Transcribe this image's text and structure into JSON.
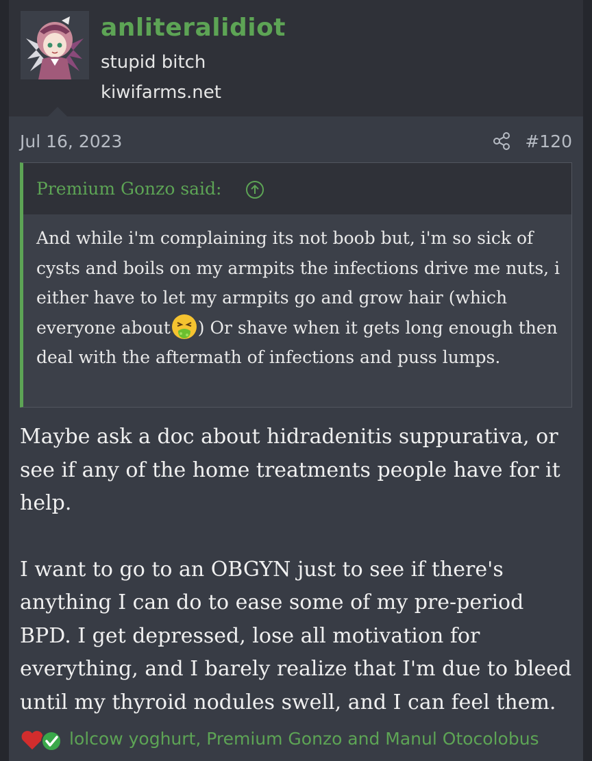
{
  "user": {
    "username": "anliteralidiot",
    "title": "stupid bitch",
    "site": "kiwifarms.net",
    "avatar_icon": "avatar-image"
  },
  "post": {
    "date": "Jul 16, 2023",
    "share_icon": "share-icon",
    "number": "#120"
  },
  "quote": {
    "attribution": "Premium Gonzo said:",
    "jump_icon": "arrow-up-circle-icon",
    "text_before_emoji": "And while i'm complaining its not boob but, i'm so sick of cysts and boils on my armpits the infections drive me nuts, i either have to let my armpits go and grow hair (which everyone about",
    "emoji": "vomiting-face-emoji",
    "text_after_emoji": ") Or shave when it gets long enough then deal with the aftermath of infections and puss lumps."
  },
  "body": {
    "paragraph_1": "Maybe ask a doc about hidradenitis suppurativa, or see if any of the home treatments people have for it help.",
    "paragraph_2": "I want to go to an OBGYN just to see if there's anything I can do to ease some of my pre-period BPD. I get depressed, lose all motivation for everything, and I barely realize that I'm due to bleed until my thyroid nodules swell, and I can feel them."
  },
  "reactions": {
    "icons": [
      "heart-icon",
      "checkmark-icon"
    ],
    "names": "lolcow yoghurt, Premium Gonzo and Manul Otocolobus"
  },
  "colors": {
    "accent": "#5da455",
    "background": "#383c45",
    "header": "#2f3138",
    "text": "#f0f0f0"
  }
}
